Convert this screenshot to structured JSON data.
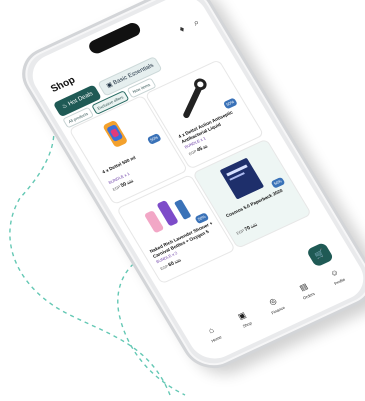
{
  "header": {
    "title": "Shop",
    "search_icon": "search-icon",
    "notification_icon": "bell-icon"
  },
  "tabs": [
    {
      "label": "Hot Deals",
      "active": true,
      "icon": "fire-icon"
    },
    {
      "label": "Basic Essentials",
      "active": false,
      "icon": "bag-icon"
    }
  ],
  "filters": [
    {
      "label": "All products",
      "active": false
    },
    {
      "label": "Exclusive offers",
      "active": true
    },
    {
      "label": "New items",
      "active": false
    }
  ],
  "products": [
    {
      "name": "4 x Dettol 500 ml",
      "discount": "50%",
      "bundle": "BUNDLE x 1",
      "currency": "EGP",
      "price": "50",
      "old_price": "100"
    },
    {
      "name": "4 x Dettol Action Antiseptic Antibacterial Liquid",
      "discount": "50%",
      "bundle": "BUNDLE x 1",
      "currency": "EGP",
      "price": "45",
      "old_price": "90"
    },
    {
      "name": "Naked Rich Lavender Shower + Carnival Bottles + Oxygen 5",
      "discount": "50%",
      "bundle": "BUNDLE x 2",
      "currency": "EGP",
      "price": "60",
      "old_price": "120"
    },
    {
      "name": "Cosmos 5.0 Paperback 2020",
      "discount": "50%",
      "bundle": "",
      "currency": "EGP",
      "price": "70",
      "old_price": "140"
    }
  ],
  "cart_button": {
    "icon": "cart-icon"
  },
  "nav": [
    {
      "label": "Home",
      "icon": "home-icon"
    },
    {
      "label": "Shop",
      "icon": "bag-icon"
    },
    {
      "label": "Finance",
      "icon": "finance-icon"
    },
    {
      "label": "Orders",
      "icon": "orders-icon"
    },
    {
      "label": "Profile",
      "icon": "profile-icon"
    }
  ],
  "colors": {
    "primary": "#1f5a55",
    "badge": "#3a72b8",
    "bundle": "#6a3ca6",
    "deco_dash": "#64c8b4"
  }
}
